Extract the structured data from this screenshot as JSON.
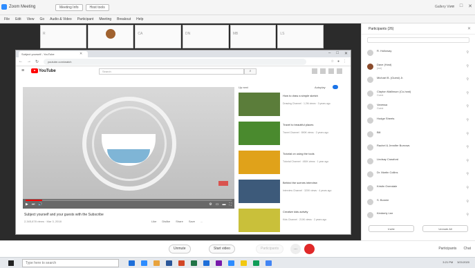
{
  "titlebar": {
    "title": "Zoom Meeting",
    "tabs": [
      "Meeting Info",
      "Host tools"
    ],
    "right_text": "Gallery View"
  },
  "menubar": {
    "items": [
      "File",
      "Edit",
      "View",
      "Go",
      "Audio & Video",
      "Participant",
      "Meeting",
      "Breakout",
      "Help"
    ]
  },
  "thumbnails": [
    {
      "lbl": "R",
      "name": "",
      "photo": false
    },
    {
      "lbl": "",
      "name": "",
      "photo": true
    },
    {
      "lbl": "CA",
      "name": "",
      "photo": false
    },
    {
      "lbl": "DN",
      "name": "",
      "photo": false
    },
    {
      "lbl": "MB",
      "name": "",
      "photo": false
    },
    {
      "lbl": "LS",
      "name": "",
      "photo": false
    }
  ],
  "chrome": {
    "tab_title": "Subject yourself - YouTube",
    "url": "youtube.com/watch"
  },
  "youtube": {
    "logo": "YouTube",
    "search_placeholder": "Search",
    "video_title": "Subject yourself and your guests with the Subscribe",
    "video_meta": "2,345,678 views · Mar 3, 2018",
    "actions": [
      "Like",
      "Dislike",
      "Share",
      "Save",
      "..."
    ],
    "up_next": "Up next",
    "autoplay": "Autoplay",
    "suggested": [
      {
        "title": "How to draw a simple sketch",
        "meta": "Drawing Channel · 1.2M views · 3 years ago",
        "color": "#5b7d3a"
      },
      {
        "title": "Travel to beautiful places",
        "meta": "Travel Channel · 890K views · 2 years ago",
        "color": "#4a8a2e"
      },
      {
        "title": "Tutorial on using the tools",
        "meta": "Tutorial Channel · 450K views · 1 year ago",
        "color": "#e0a21a"
      },
      {
        "title": "Behind the scenes interview",
        "meta": "Interview Channel · 320K views · 4 years ago",
        "color": "#3d5a7a"
      },
      {
        "title": "Creative kids activity",
        "meta": "Kids Channel · 210K views · 2 years ago",
        "color": "#c9c03a"
      }
    ]
  },
  "panel": {
    "title": "Participants (26)",
    "participants": [
      {
        "name": "R. Holloway",
        "sub": "",
        "photo": false
      },
      {
        "name": "Dave (Host)",
        "sub": "(me)",
        "photo": true
      },
      {
        "name": "Michael B. (Guest) Jr.",
        "sub": "",
        "photo": false
      },
      {
        "name": "Clayton Mallinson (Co-host)",
        "sub": "Guest",
        "photo": false
      },
      {
        "name": "Vanessa",
        "sub": "Guest",
        "photo": false
      },
      {
        "name": "Hodge Sheets",
        "sub": "",
        "photo": false
      },
      {
        "name": "Bill",
        "sub": "",
        "photo": false
      },
      {
        "name": "Rachel & Jennifer Burrows",
        "sub": "",
        "photo": false
      },
      {
        "name": "Lindsay Crawford",
        "sub": "",
        "photo": false
      },
      {
        "name": "Dr. Martin Collins",
        "sub": "",
        "photo": false
      },
      {
        "name": "Kristin Oxendale",
        "sub": "",
        "photo": false
      },
      {
        "name": "S. Bonnie",
        "sub": "",
        "photo": false
      },
      {
        "name": "Kimberly Lee",
        "sub": "",
        "photo": false
      }
    ],
    "buttons": [
      "Invite",
      "Unmute All"
    ]
  },
  "bottombar": {
    "buttons": [
      "Unmute",
      "Start video",
      "Participants"
    ],
    "more": "...",
    "right": [
      "Participants",
      "Chat"
    ]
  },
  "taskbar": {
    "search_placeholder": "Type here to search",
    "time": "3:21 PM",
    "date": "3/21/2020",
    "app_colors": [
      "#1e6fd9",
      "#2d8cff",
      "#e8a33d",
      "#2b579a",
      "#d24726",
      "#217346",
      "#1e6fd9",
      "#7719aa",
      "#2d8cff",
      "#f2c811",
      "#0f9d58",
      "#4285f4"
    ]
  }
}
